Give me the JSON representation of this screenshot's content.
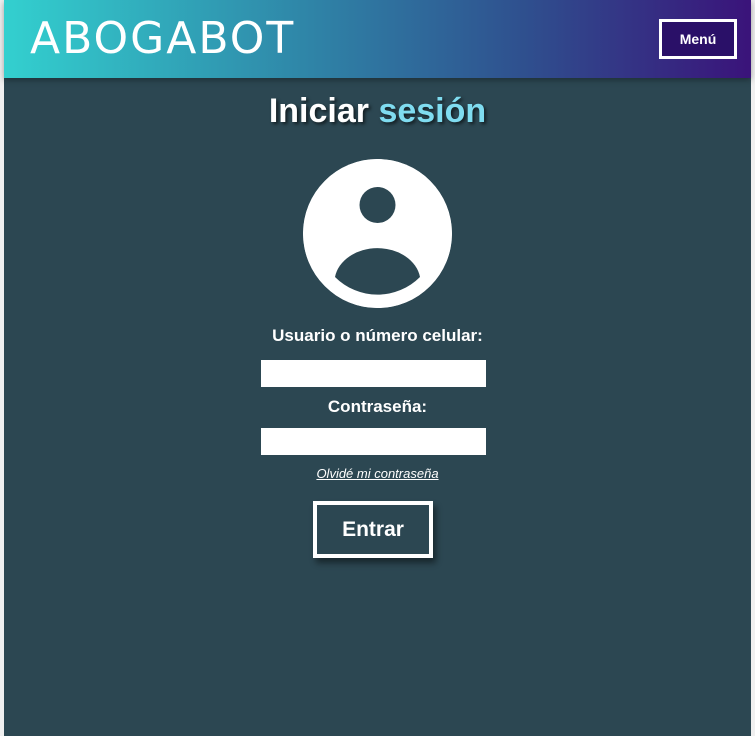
{
  "header": {
    "logo_text": "ABOGABOT",
    "menu_label": "Menú"
  },
  "login": {
    "title_part1": "Iniciar",
    "title_part2": "sesión",
    "username_label": "Usuario o número celular:",
    "username_value": "",
    "password_label": "Contraseña:",
    "password_value": "",
    "forgot_link": "Olvidé mi contraseña",
    "submit_label": "Entrar"
  },
  "colors": {
    "background": "#2c4752",
    "header_gradient_start": "#33d0cf",
    "header_gradient_end": "#3a137a",
    "title_accent": "#7fdcf0",
    "menu_button_bg": "#2a1068"
  },
  "icons": {
    "avatar": "user-avatar-icon"
  }
}
